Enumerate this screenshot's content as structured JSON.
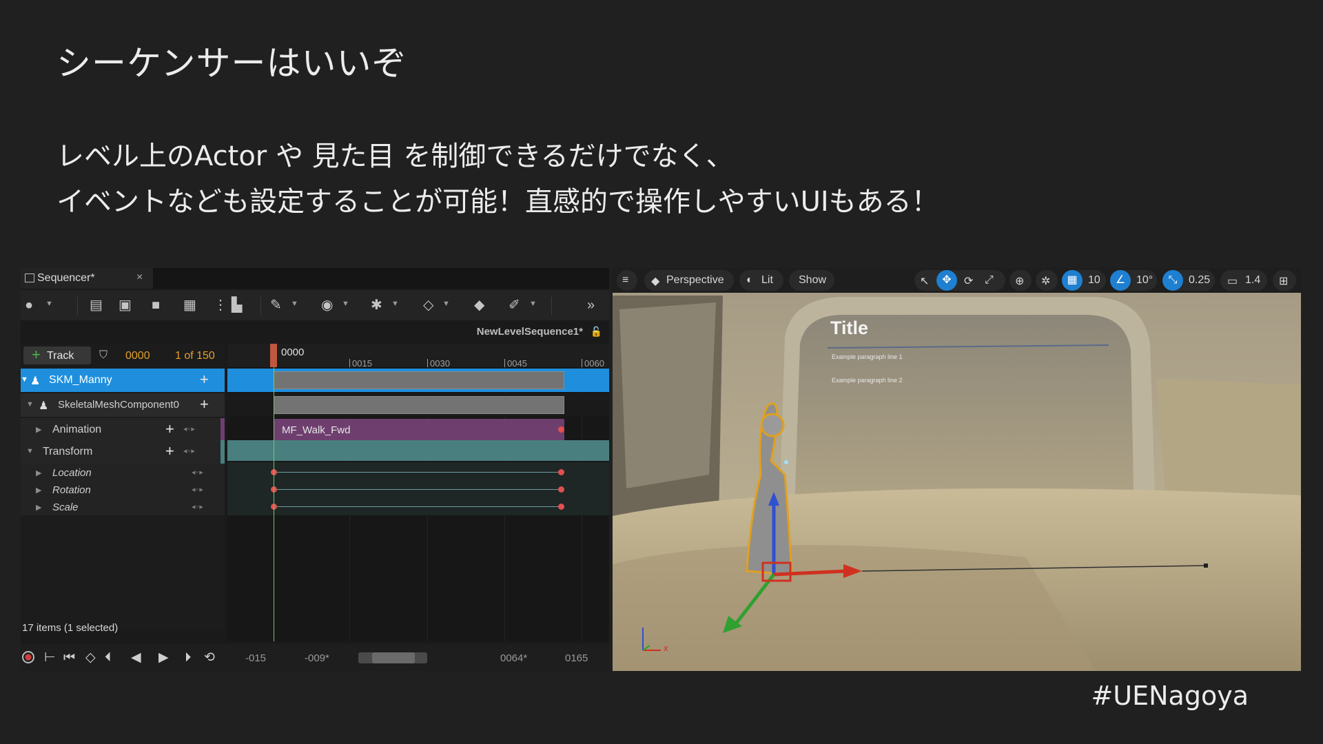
{
  "slide": {
    "title": "シーケンサーはいいぞ",
    "body_line1": "レベル上のActor や 見た目 を制御できるだけでなく、",
    "body_line2": "イベントなども設定することが可能！直感的で操作しやすいUIもある！",
    "hashtag": "#UENagoya"
  },
  "sequencer": {
    "tab_label": "Sequencer*",
    "tab_close": "×",
    "sequence_name": "NewLevelSequence1*",
    "track_button": "Track",
    "current_frame": "0000",
    "frame_count": "1 of 150",
    "playhead_label": "0000",
    "ruler_ticks": [
      "0015",
      "0030",
      "0045",
      "0060"
    ],
    "rows": {
      "actor": "SKM_Manny",
      "component": "SkeletalMeshComponent0",
      "animation": "Animation",
      "transform": "Transform",
      "location": "Location",
      "rotation": "Rotation",
      "scale": "Scale"
    },
    "anim_clip": "MF_Walk_Fwd",
    "status": "17 items (1 selected)",
    "range": {
      "start_out": "-015",
      "start_in": "-009*",
      "end_in": "0064*",
      "end_out": "0165"
    }
  },
  "viewport": {
    "perspective": "Perspective",
    "lit": "Lit",
    "show": "Show",
    "grid_snap": "10",
    "rot_snap": "10°",
    "scale_snap": "0.25",
    "camera_speed": "1.4",
    "widget_title": "Title",
    "para1": "Example paragraph line 1",
    "para2": "Example paragraph line 2"
  },
  "colors": {
    "selection_blue": "#1f8fdd",
    "frame_orange": "#e2a02b",
    "anim_purple": "#6e3f6e",
    "transform_teal": "#4a7f7f",
    "key_red": "#e05050",
    "playhead_green": "#6fcf5f"
  }
}
